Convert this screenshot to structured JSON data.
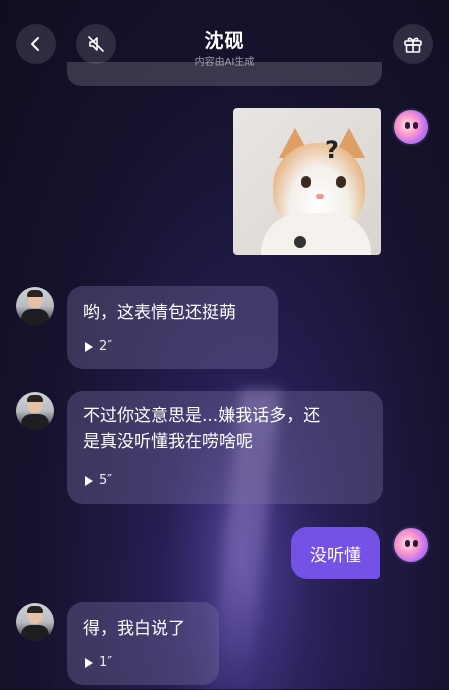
{
  "header": {
    "title": "沈砚",
    "subtitle": "内容由AI生成",
    "icons": {
      "back": "chevron-left-icon",
      "mute": "speaker-muted-icon",
      "gift": "gift-icon"
    }
  },
  "messages": [
    {
      "from": "ai",
      "text": "哟，这表情包还挺萌",
      "duration": "2″"
    },
    {
      "from": "ai",
      "text_line1": "不过你这意思是...嫌我话多，还",
      "text_line2": "是真没听懂我在唠啥呢",
      "duration": "5″"
    },
    {
      "from": "me",
      "text": "没听懂"
    },
    {
      "from": "ai",
      "text": "得，我白说了",
      "duration": "1″"
    }
  ],
  "sticker": {
    "symbol": "?"
  },
  "colors": {
    "accent": "#7552e6",
    "bubble": "#6f6a93"
  }
}
